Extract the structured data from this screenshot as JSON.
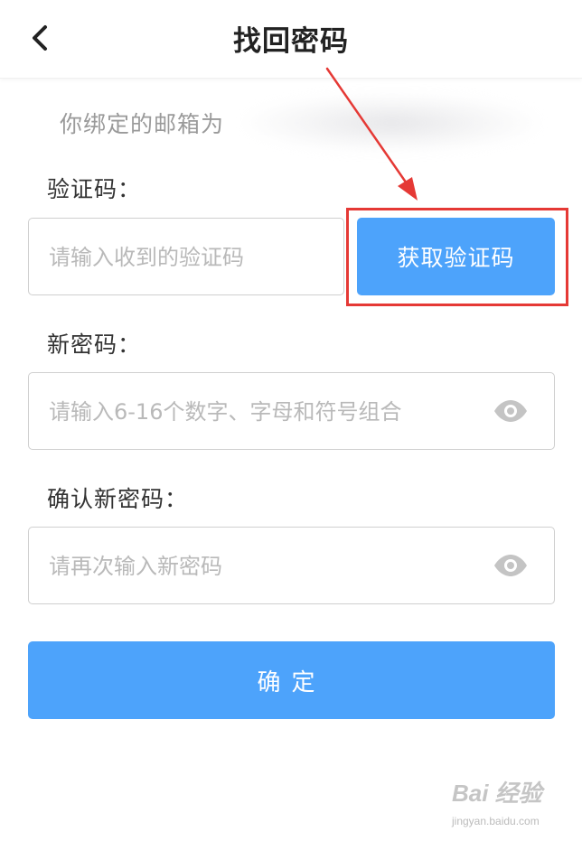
{
  "header": {
    "title": "找回密码",
    "back_icon": "chevron-left-icon"
  },
  "email_hint": {
    "label": "你绑定的邮箱为"
  },
  "verification": {
    "label": "验证码：",
    "placeholder": "请输入收到的验证码",
    "button_label": "获取验证码"
  },
  "new_password": {
    "label": "新密码：",
    "placeholder": "请输入6-16个数字、字母和符号组合",
    "eye_icon": "eye-icon"
  },
  "confirm_password": {
    "label": "确认新密码：",
    "placeholder": "请再次输入新密码",
    "eye_icon": "eye-icon"
  },
  "confirm_button": {
    "label": "确定"
  },
  "annotation": {
    "highlight_color": "#e53935"
  },
  "watermark": {
    "brand": "Bai 经验",
    "url": "jingyan.baidu.com"
  },
  "colors": {
    "primary": "#4da3fb",
    "placeholder": "#b9b9b9",
    "label": "#333333"
  }
}
